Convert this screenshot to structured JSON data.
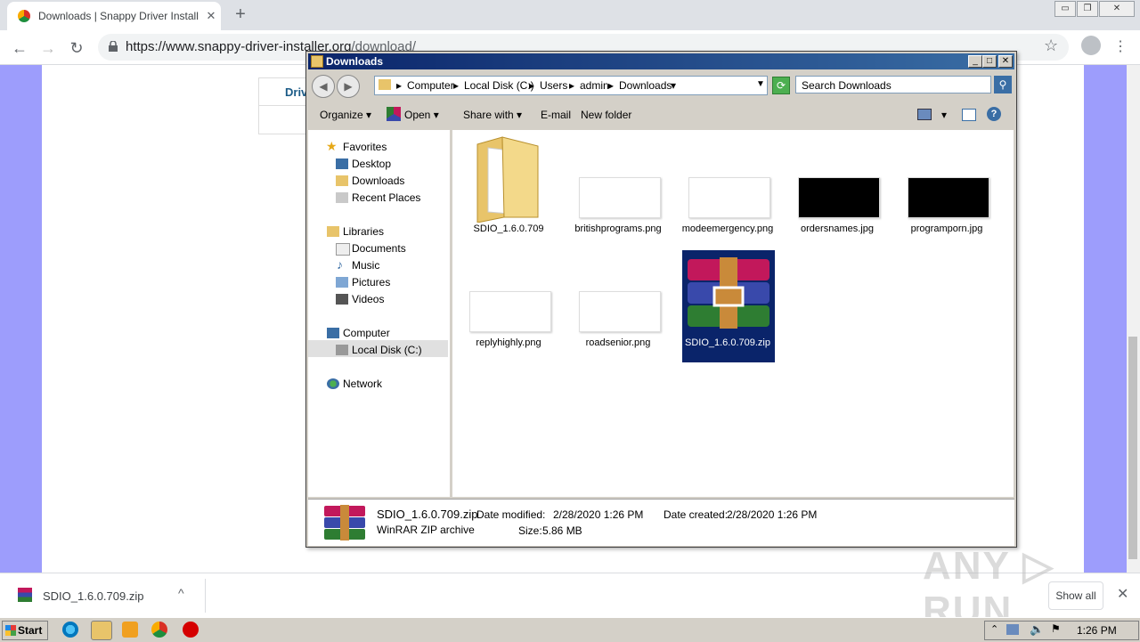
{
  "browser": {
    "tab_title": "Downloads | Snappy Driver Installer",
    "tab_close": "✕",
    "new_tab": "+",
    "url_host": "https://www.snappy-driver-installer.org",
    "url_path": "/download/",
    "nav_back": "←",
    "nav_forward": "→",
    "nav_reload": "↻",
    "star": "☆",
    "menu": "⋮",
    "win_min": "▭",
    "win_max": "❐",
    "win_close": "✕"
  },
  "page": {
    "partial_text": "Driv"
  },
  "explorer": {
    "title": "Downloads",
    "caption_min": "_",
    "caption_max": "□",
    "caption_close": "✕",
    "nav_back": "◀",
    "nav_forward": "▶",
    "breadcrumbs": [
      "Computer",
      "Local Disk (C:)",
      "Users",
      "admin",
      "Downloads"
    ],
    "search_placeholder": "Search Downloads",
    "commands": {
      "organize": "Organize",
      "open": "Open",
      "share_with": "Share with",
      "email": "E-mail",
      "new_folder": "New folder"
    },
    "nav": {
      "favorites": "Favorites",
      "desktop": "Desktop",
      "downloads": "Downloads",
      "recent_places": "Recent Places",
      "libraries": "Libraries",
      "documents": "Documents",
      "music": "Music",
      "pictures": "Pictures",
      "videos": "Videos",
      "computer": "Computer",
      "local_disk": "Local Disk (C:)",
      "network": "Network"
    },
    "files": [
      {
        "name": "SDIO_1.6.0.709",
        "type": "folder"
      },
      {
        "name": "britishprograms.png",
        "type": "png-white"
      },
      {
        "name": "modeemergency.png",
        "type": "png-white"
      },
      {
        "name": "ordersnames.jpg",
        "type": "jpg-black"
      },
      {
        "name": "programporn.jpg",
        "type": "jpg-black"
      },
      {
        "name": "replyhighly.png",
        "type": "png-white"
      },
      {
        "name": "roadsenior.png",
        "type": "png-white"
      },
      {
        "name": "SDIO_1.6.0.709.zip",
        "type": "zip",
        "selected": true
      }
    ],
    "details": {
      "filename": "SDIO_1.6.0.709.zip",
      "filetype": "WinRAR ZIP archive",
      "date_modified_label": "Date modified:",
      "date_modified": "2/28/2020 1:26 PM",
      "date_created_label": "Date created:",
      "date_created": "2/28/2020 1:26 PM",
      "size_label": "Size:",
      "size": "5.86 MB"
    }
  },
  "download_shelf": {
    "filename": "SDIO_1.6.0.709.zip",
    "show_all": "Show all",
    "chevron": "^",
    "close": "✕"
  },
  "taskbar": {
    "start": "Start",
    "clock": "1:26 PM"
  },
  "watermark": "ANY ▷ RUN"
}
